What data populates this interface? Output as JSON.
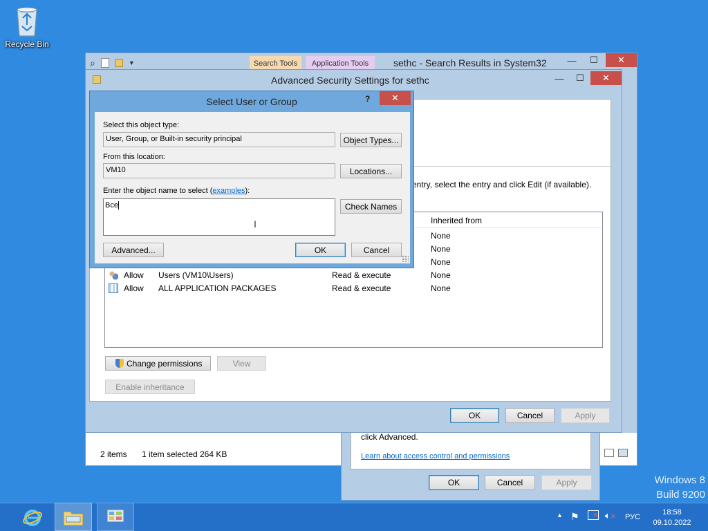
{
  "desktop": {
    "recycle_bin_label": "Recycle Bin",
    "watermark_line1": "Windows 8",
    "watermark_line2": "Build 9200"
  },
  "explorer": {
    "title": "sethc - Search Results in System32",
    "tab_search_tools": "Search Tools",
    "tab_application_tools": "Application Tools",
    "status_items": "2 items",
    "status_selected": "1 item selected",
    "status_size": "264 KB"
  },
  "properties_dialog": {
    "advanced_text": "click Advanced.",
    "learn_link": "Learn about access control and permissions",
    "ok": "OK",
    "cancel": "Cancel",
    "apply": "Apply"
  },
  "advanced_security": {
    "title": "Advanced Security Settings for sethc",
    "instruction_fragment": "entry, select the entry and click Edit (if available).",
    "column_inherited": "Inherited from",
    "rows": [
      {
        "type": "",
        "principal": "",
        "access": "",
        "inherited": "None"
      },
      {
        "type": "",
        "principal": "",
        "access": "",
        "inherited": "None"
      },
      {
        "type": "",
        "principal": "",
        "access": "",
        "inherited": "None"
      },
      {
        "type": "Allow",
        "principal": "Users (VM10\\Users)",
        "access": "Read & execute",
        "inherited": "None"
      },
      {
        "type": "Allow",
        "principal": "ALL APPLICATION PACKAGES",
        "access": "Read & execute",
        "inherited": "None"
      }
    ],
    "change_permissions": "Change permissions",
    "view": "View",
    "enable_inheritance": "Enable inheritance",
    "ok": "OK",
    "cancel": "Cancel",
    "apply": "Apply"
  },
  "select_user": {
    "title": "Select User or Group",
    "help": "?",
    "object_type_label": "Select this object type:",
    "object_type_value": "User, Group, or Built-in security principal",
    "object_types_button": "Object Types...",
    "location_label": "From this location:",
    "location_value": "VM10",
    "locations_button": "Locations...",
    "object_name_label_pre": "Enter the object name to select (",
    "object_name_link": "examples",
    "object_name_label_post": "):",
    "object_name_value": "Все",
    "check_names_button": "Check Names",
    "advanced_button": "Advanced...",
    "ok_button": "OK",
    "cancel_button": "Cancel"
  },
  "taskbar": {
    "language": "РУС",
    "time": "18:58",
    "date": "09.10.2022"
  }
}
